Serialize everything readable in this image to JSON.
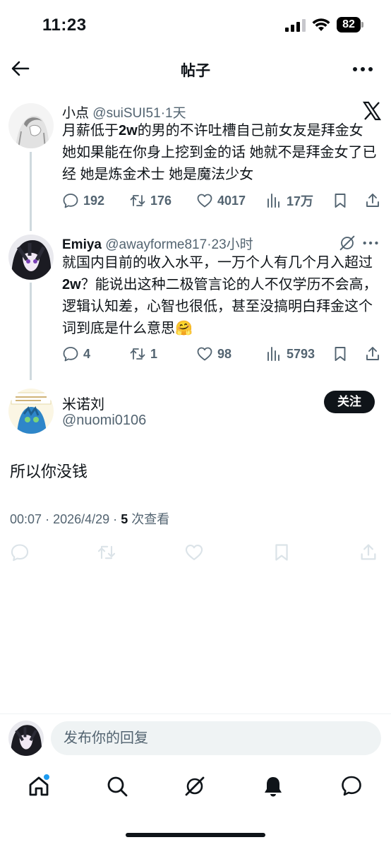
{
  "status_bar": {
    "time": "11:23",
    "battery": "82"
  },
  "header": {
    "title": "帖子"
  },
  "posts": [
    {
      "author": "小点",
      "handle": "@suiSUI51",
      "dot": "·",
      "time": "1天",
      "text_parts": [
        "月薪低于",
        "2w",
        "的男的不许吐槽自己前女友是拜金女 她如果能在你身上挖到金的话 她就不是拜金女了已经 她是炼金术士 她是魔法少女"
      ],
      "replies": "192",
      "reposts": "176",
      "likes": "4017",
      "views": "17万"
    },
    {
      "author": "Emiya",
      "handle": "@awayforme817",
      "dot": "·",
      "time": "23小时",
      "text_parts": [
        "就国内目前的收入水平，一万个人有几个月入超过",
        "2w",
        "？能说出这种二极管言论的人不仅学历不会高，逻辑认知差，心智也很低，甚至没搞明白拜金这个词到底是什么意思",
        "🤗"
      ],
      "replies": "4",
      "reposts": "1",
      "likes": "98",
      "views": "5793"
    }
  ],
  "main_post": {
    "author": "米诺刘",
    "handle": "@nuomi0106",
    "follow_label": "关注",
    "text": "所以你没钱",
    "time": "00:07",
    "dot": "·",
    "date": "2026/4/29",
    "views_count": "5",
    "views_label": "次查看"
  },
  "reply_bar": {
    "placeholder": "发布你的回复"
  },
  "nav": {
    "items": [
      "home-icon",
      "search-icon",
      "grok-icon",
      "notifications-icon",
      "messages-icon"
    ]
  },
  "colors": {
    "text": "#0f1419",
    "secondary": "#536471",
    "accent": "#1d9bf0",
    "line": "#cfd9de"
  }
}
